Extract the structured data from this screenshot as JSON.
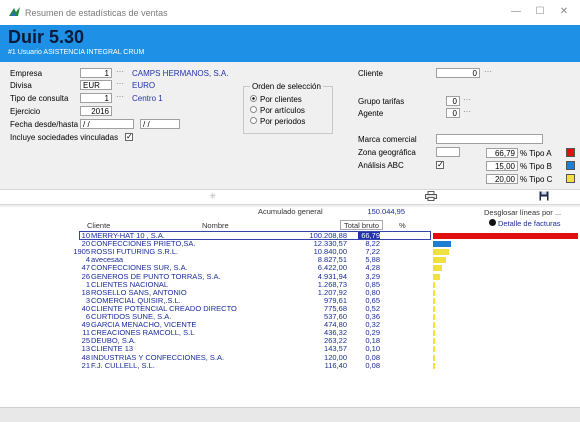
{
  "window": {
    "title": "Resumen de estadísticas de ventas",
    "minimize": "—",
    "maximize": "☐",
    "close": "✕"
  },
  "header": {
    "title": "Duir 5.30",
    "subtitle": "#1 Usuario  ASISTENCIA INTEGRAL CRUM"
  },
  "form": {
    "empresa": {
      "label": "Empresa",
      "code": "1",
      "name": "CAMPS HERMANOS, S.A."
    },
    "divisa": {
      "label": "Divisa",
      "code": "EUR",
      "name": "EURO"
    },
    "tipo_consulta": {
      "label": "Tipo de consulta",
      "code": "1",
      "name": "Centro 1"
    },
    "ejercicio": {
      "label": "Ejercicio",
      "value": "2016"
    },
    "fecha": {
      "label": "Fecha desde/hasta",
      "from": "/ /",
      "to": "/ /"
    },
    "incluye": {
      "label": "Incluye sociedades vinculadas",
      "checked": true
    },
    "orden": {
      "label": "Orden de selección",
      "options": [
        "Por clientes",
        "Por artículos",
        "Por periodos"
      ],
      "selected": "Por clientes"
    },
    "cliente": {
      "label": "Cliente",
      "value": "0"
    },
    "grupo_tarifas": {
      "label": "Grupo tarifas",
      "value": "0"
    },
    "agente": {
      "label": "Agente",
      "value": "0"
    },
    "marca": {
      "label": "Marca comercial",
      "value": ""
    },
    "zona": {
      "label": "Zona geográfica",
      "value": ""
    },
    "abc": {
      "label": "Análisis ABC",
      "checked": true,
      "types": [
        {
          "pct": "66,79",
          "label": "% Tipo A",
          "color": "#e01010"
        },
        {
          "pct": "15,00",
          "label": "% Tipo B",
          "color": "#1e7fd0"
        },
        {
          "pct": "20,00",
          "label": "% Tipo C",
          "color": "#f0e040"
        }
      ]
    }
  },
  "dots": "⋯",
  "toolbar": {
    "print_icon": "printer-icon",
    "save_icon": "save-icon",
    "loading_icon": "spinner-icon"
  },
  "summary": {
    "label": "Acumulado general",
    "value": "150.044,95",
    "desglosar": "Desglosar líneas por ...",
    "detalle": "Detalle de facturas"
  },
  "table": {
    "col_cliente": "Cliente",
    "col_nombre": "Nombre",
    "col_bruto": "Total bruto",
    "col_pct": "%",
    "rows": [
      {
        "id": "10",
        "name": "MERRY-HAT 10 , S.A.",
        "bruto": "100.208,88",
        "pct": "66,79",
        "frac": 0.6679,
        "color": "#e01010"
      },
      {
        "id": "20",
        "name": "CONFECCIONES PRIETO,SA.",
        "bruto": "12.330,57",
        "pct": "8,22",
        "frac": 0.0822,
        "color": "#1e7fd0"
      },
      {
        "id": "1905",
        "name": "ROSSI FUTURING S.R.L.",
        "bruto": "10.840,00",
        "pct": "7,22",
        "frac": 0.0722,
        "color": "#f0e040"
      },
      {
        "id": "4",
        "name": "avecesaa",
        "bruto": "8.827,51",
        "pct": "5,88",
        "frac": 0.0588,
        "color": "#f0e040"
      },
      {
        "id": "47",
        "name": "CONFECCIONES SUR, S.A.",
        "bruto": "6.422,00",
        "pct": "4,28",
        "frac": 0.0428,
        "color": "#f0e040"
      },
      {
        "id": "26",
        "name": "GENEROS DE PUNTO TORRAS, S.A.",
        "bruto": "4.931,94",
        "pct": "3,29",
        "frac": 0.0329,
        "color": "#f0e040"
      },
      {
        "id": "1",
        "name": "CLIENTES NACIONAL",
        "bruto": "1.268,73",
        "pct": "0,85",
        "frac": 0.0085,
        "color": "#f0e040"
      },
      {
        "id": "18",
        "name": "ROSELLO SANS, ANTONIO",
        "bruto": "1.207,92",
        "pct": "0,80",
        "frac": 0.008,
        "color": "#f0e040"
      },
      {
        "id": "3",
        "name": "COMERCIAL QUISIR,.S.L.",
        "bruto": "979,61",
        "pct": "0,65",
        "frac": 0.0065,
        "color": "#f0e040"
      },
      {
        "id": "40",
        "name": "CLIENTE POTENCIAL CREADO DIRECTO",
        "bruto": "775,68",
        "pct": "0,52",
        "frac": 0.0052,
        "color": "#f0e040"
      },
      {
        "id": "6",
        "name": "CURTIDOS SUNE, S.A.",
        "bruto": "537,60",
        "pct": "0,36",
        "frac": 0.0036,
        "color": "#f0e040"
      },
      {
        "id": "49",
        "name": "GARCIA MENACHO, VICENTE",
        "bruto": "474,80",
        "pct": "0,32",
        "frac": 0.0032,
        "color": "#f0e040"
      },
      {
        "id": "11",
        "name": "CREACIONES RAMCOLL, S.L",
        "bruto": "436,32",
        "pct": "0,29",
        "frac": 0.0029,
        "color": "#f0e040"
      },
      {
        "id": "25",
        "name": "DEUBO, S.A.",
        "bruto": "263,22",
        "pct": "0,18",
        "frac": 0.0018,
        "color": "#f0e040"
      },
      {
        "id": "13",
        "name": "CLIENTE 13",
        "bruto": "143,57",
        "pct": "0,10",
        "frac": 0.001,
        "color": "#f0e040"
      },
      {
        "id": "48",
        "name": "INDUSTRIAS Y CONFECCIONES, S.A.",
        "bruto": "120,00",
        "pct": "0,08",
        "frac": 0.0008,
        "color": "#f0e040"
      },
      {
        "id": "21",
        "name": "F.J. CULLELL, S.L.",
        "bruto": "116,40",
        "pct": "0,08",
        "frac": 0.0008,
        "color": "#f0e040"
      }
    ]
  }
}
